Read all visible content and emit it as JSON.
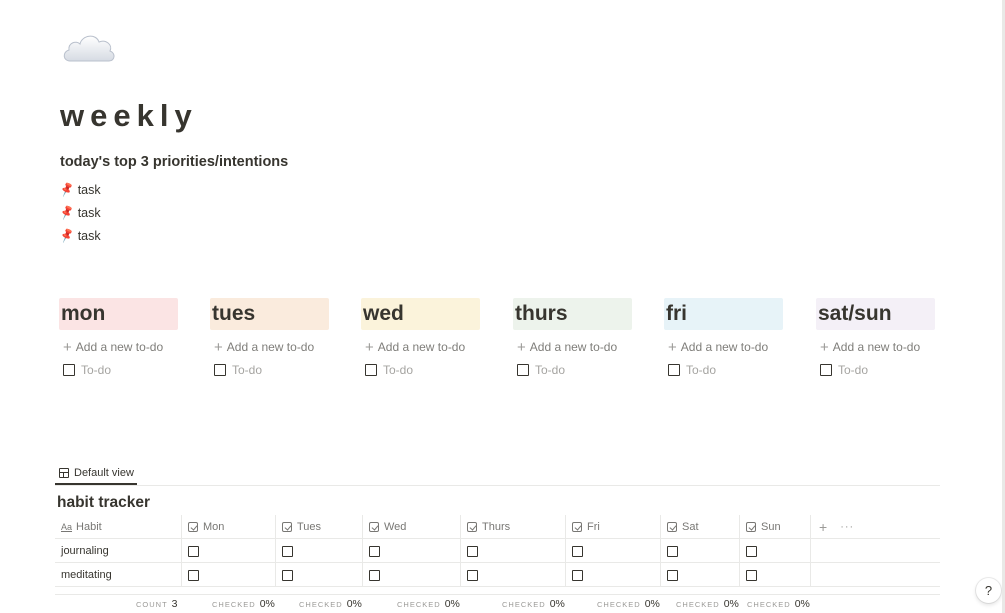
{
  "page": {
    "icon": "cloud-icon",
    "title": "weekly",
    "priorities_heading": "today's top 3 priorities/intentions",
    "priorities": [
      {
        "icon": "pushpin-icon",
        "label": "task"
      },
      {
        "icon": "pushpin-icon",
        "label": "task"
      },
      {
        "icon": "pushpin-icon",
        "label": "task"
      }
    ]
  },
  "days": [
    {
      "label": "mon",
      "color": "#fbe4e4",
      "add_label": "Add a new to-do",
      "todo_label": "To-do"
    },
    {
      "label": "tues",
      "color": "#faebdd",
      "add_label": "Add a new to-do",
      "todo_label": "To-do"
    },
    {
      "label": "wed",
      "color": "#fbf3db",
      "add_label": "Add a new to-do",
      "todo_label": "To-do"
    },
    {
      "label": "thurs",
      "color": "#edf3ec",
      "add_label": "Add a new to-do",
      "todo_label": "To-do"
    },
    {
      "label": "fri",
      "color": "#e7f3f8",
      "add_label": "Add a new to-do",
      "todo_label": "To-do"
    },
    {
      "label": "sat/sun",
      "color": "#f4f0f7",
      "add_label": "Add a new to-do",
      "todo_label": "To-do"
    }
  ],
  "database": {
    "view_tab": "Default view",
    "title": "habit tracker",
    "columns": [
      {
        "label": "Habit",
        "icon": "text-property-icon"
      },
      {
        "label": "Mon",
        "icon": "checkbox-property-icon"
      },
      {
        "label": "Tues",
        "icon": "checkbox-property-icon"
      },
      {
        "label": "Wed",
        "icon": "checkbox-property-icon"
      },
      {
        "label": "Thurs",
        "icon": "checkbox-property-icon"
      },
      {
        "label": "Fri",
        "icon": "checkbox-property-icon"
      },
      {
        "label": "Sat",
        "icon": "checkbox-property-icon"
      },
      {
        "label": "Sun",
        "icon": "checkbox-property-icon"
      }
    ],
    "add_column_icon": "plus-icon",
    "more_icon": "more-icon",
    "rows": [
      {
        "habit": "journaling",
        "checks": [
          false,
          false,
          false,
          false,
          false,
          false,
          false
        ]
      },
      {
        "habit": "meditating",
        "checks": [
          false,
          false,
          false,
          false,
          false,
          false,
          false
        ]
      }
    ],
    "calculations": [
      {
        "label": "COUNT",
        "value": "3"
      },
      {
        "label": "CHECKED",
        "value": "0%"
      },
      {
        "label": "CHECKED",
        "value": "0%"
      },
      {
        "label": "CHECKED",
        "value": "0%"
      },
      {
        "label": "CHECKED",
        "value": "0%"
      },
      {
        "label": "CHECKED",
        "value": "0%"
      },
      {
        "label": "CHECKED",
        "value": "0%"
      },
      {
        "label": "CHECKED",
        "value": "0%"
      }
    ]
  },
  "help_button": "?"
}
